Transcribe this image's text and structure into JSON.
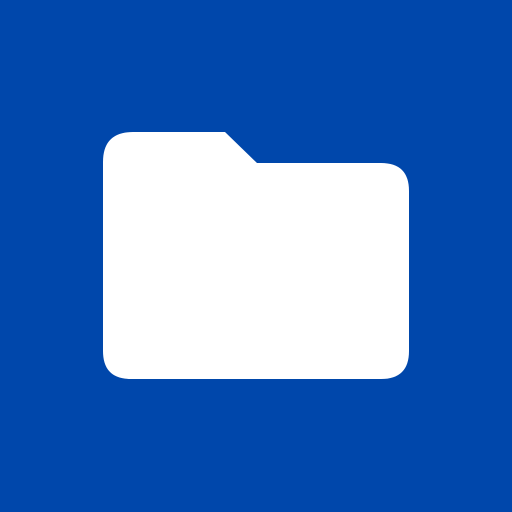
{
  "app_icon": {
    "icon": "folder-icon",
    "background_color": "#0047ab",
    "icon_color": "#ffffff"
  }
}
